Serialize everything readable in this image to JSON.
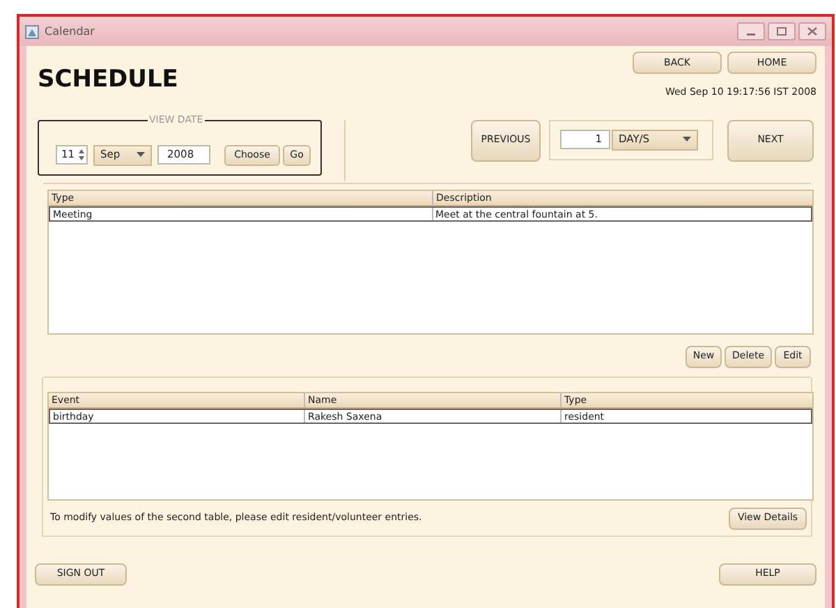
{
  "window": {
    "title": "Calendar"
  },
  "heading": "SCHEDULE",
  "nav_buttons": [
    "BACK",
    "HOME"
  ],
  "datetime": "Wed Sep 10 19:17:56 IST 2008",
  "view_date": {
    "legend": "VIEW DATE",
    "day": "11",
    "month": "Sep",
    "year": "2008",
    "buttons": [
      "Choose",
      "Go"
    ]
  },
  "period": {
    "previous": "PREVIOUS",
    "count": "1",
    "unit": "DAY/S",
    "next": "NEXT"
  },
  "schedule_table": {
    "columns": [
      "Type",
      "Description"
    ],
    "rows": [
      {
        "cells": [
          "Meeting",
          "Meet at the central fountain at 5."
        ],
        "selected": true
      }
    ]
  },
  "schedule_buttons": [
    "New",
    "Delete",
    "Edit"
  ],
  "events_table": {
    "columns": [
      "Event",
      "Name",
      "Type"
    ],
    "rows": [
      {
        "cells": [
          "birthday",
          "Rakesh Saxena",
          "resident"
        ],
        "selected": true
      }
    ]
  },
  "note": "To modify values of the second table, please edit resident/volunteer entries.",
  "view_details": "View Details",
  "footer_buttons": [
    "SIGN OUT",
    "HELP"
  ]
}
